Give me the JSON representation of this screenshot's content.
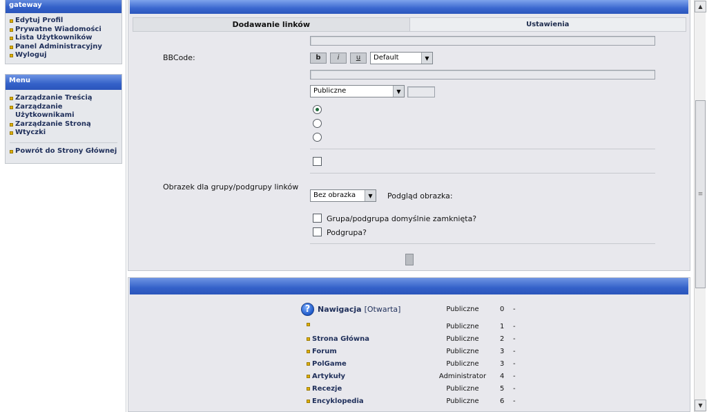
{
  "sidebar": {
    "user_box": {
      "title": "gateway",
      "items": [
        "Edytuj Profil",
        "Prywatne Wiadomości",
        "Lista Użytkowników",
        "Panel Administracyjny",
        "Wyloguj"
      ]
    },
    "menu_box": {
      "title": "Menu",
      "items": [
        "Zarządzanie Treścią",
        "Zarządzanie Użytkownikami",
        "Zarządzanie Stroną",
        "Wtyczki"
      ],
      "back": "Powrót do Strony Głównej"
    }
  },
  "tabs": {
    "add_links": "Dodawanie linków",
    "settings": "Ustawienia"
  },
  "form": {
    "bbcode_label": "BBCode:",
    "bold": "b",
    "italic": "i",
    "underline": "u",
    "font_select": "Default",
    "access_select": "Publiczne",
    "image_label": "Obrazek dla grupy/podgrupy linków",
    "image_select": "Bez obrazka",
    "preview_label": "Podgląd obrazka:",
    "closed_label": "Grupa/podgrupa domyślnie zamknięta?",
    "subgroup_label": "Podgrupa?"
  },
  "nav": {
    "header_name": "Nawigacja",
    "header_status": "[Otwarta]",
    "header_access": "Publiczne",
    "header_order": "0",
    "dash": "-",
    "rows": [
      {
        "name": "",
        "access": "Publiczne",
        "order": "1"
      },
      {
        "name": "Strona Główna",
        "access": "Publiczne",
        "order": "2"
      },
      {
        "name": "Forum",
        "access": "Publiczne",
        "order": "3"
      },
      {
        "name": "PolGame",
        "access": "Publiczne",
        "order": "3"
      },
      {
        "name": "Artykuły",
        "access": "Administrator",
        "order": "4"
      },
      {
        "name": "Recezje",
        "access": "Publiczne",
        "order": "5"
      },
      {
        "name": "Encyklopedia",
        "access": "Publiczne",
        "order": "6"
      }
    ]
  },
  "icons": {
    "help": "question-mark-icon",
    "bullet": "square-bullet-icon"
  }
}
